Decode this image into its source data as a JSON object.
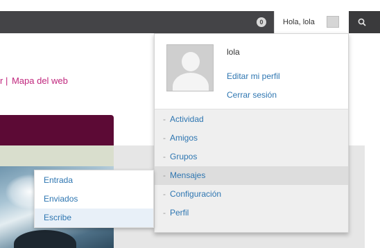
{
  "topbar": {
    "notification_icon": "notification-bubble-icon",
    "notification_count": "0",
    "greeting": "Hola, lola",
    "avatar_icon": "user-avatar-icon",
    "search_icon": "search-icon"
  },
  "page": {
    "breadcrumb_separator": "r |",
    "sitemap_link": "Mapa del web"
  },
  "account_menu": {
    "username": "lola",
    "avatar_icon": "profile-placeholder-icon",
    "edit_profile": "Editar mi perfil",
    "logout": "Cerrar sesión",
    "items": [
      {
        "label": "Actividad"
      },
      {
        "label": "Amigos"
      },
      {
        "label": "Grupos"
      },
      {
        "label": "Mensajes",
        "active": true
      },
      {
        "label": "Configuración"
      },
      {
        "label": "Perfil"
      }
    ],
    "dash": "-"
  },
  "messages_submenu": {
    "items": [
      {
        "label": "Entrada"
      },
      {
        "label": "Enviados"
      },
      {
        "label": "Escribe",
        "hovered": true
      }
    ]
  },
  "colors": {
    "topbar_bg": "#444447",
    "link_blue": "#2e76b1",
    "link_magenta": "#c0267d",
    "header_purple": "#5c0a35"
  }
}
